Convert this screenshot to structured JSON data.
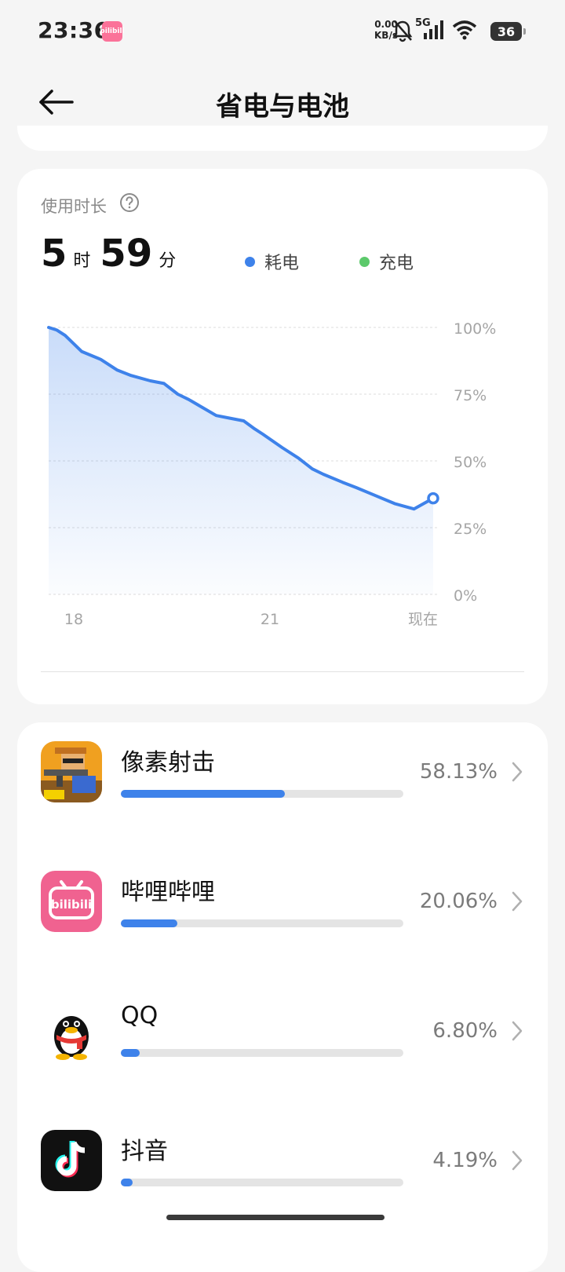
{
  "status_bar": {
    "time": "23:36",
    "app_badge": "bilibili",
    "net_speed": "0.00",
    "net_unit": "KB/s",
    "network_type": "5G",
    "battery_level": "36",
    "icons": [
      "bilibili-badge-icon",
      "mute-bell-icon",
      "signal-icon",
      "wifi-icon",
      "battery-icon"
    ]
  },
  "header": {
    "title": "省电与电池",
    "back_icon": "back-arrow-icon"
  },
  "usage": {
    "label": "使用时长",
    "hours": "5",
    "hours_unit": "时",
    "minutes": "59",
    "minutes_unit": "分",
    "legend": [
      {
        "label": "耗电",
        "color": "#3e82ea"
      },
      {
        "label": "充电",
        "color": "#5cc96b"
      }
    ]
  },
  "chart_data": {
    "type": "area",
    "x_tick_labels": [
      "18",
      "21",
      "现在"
    ],
    "y_tick_labels": [
      "100%",
      "75%",
      "50%",
      "25%",
      "0%"
    ],
    "ylim": [
      0,
      100
    ],
    "grid": true,
    "series": [
      {
        "name": "耗电",
        "color": "#3e82ea",
        "x": [
          0,
          3,
          6,
          12,
          19,
          25,
          30,
          37,
          42,
          47,
          51,
          56,
          61,
          66,
          71,
          75,
          78,
          85,
          91,
          96,
          100,
          107,
          112,
          119,
          126,
          133,
          140
        ],
        "values": [
          100,
          99,
          97,
          91,
          88,
          84,
          82,
          80,
          79,
          75,
          73,
          70,
          67,
          66,
          65,
          62,
          60,
          55,
          51,
          47,
          45,
          42,
          40,
          37,
          34,
          32,
          36
        ]
      }
    ],
    "end_marker": true
  },
  "apps": [
    {
      "name": "像素射击",
      "percent_label": "58.13%",
      "share": 58.13,
      "icon": "pixel-shooter-app-icon"
    },
    {
      "name": "哔哩哔哩",
      "percent_label": "20.06%",
      "share": 20.06,
      "icon": "bilibili-app-icon",
      "icon_text": "bilibili"
    },
    {
      "name": "QQ",
      "percent_label": "6.80%",
      "share": 6.8,
      "icon": "qq-app-icon"
    },
    {
      "name": "抖音",
      "percent_label": "4.19%",
      "share": 4.19,
      "icon": "douyin-app-icon"
    }
  ]
}
